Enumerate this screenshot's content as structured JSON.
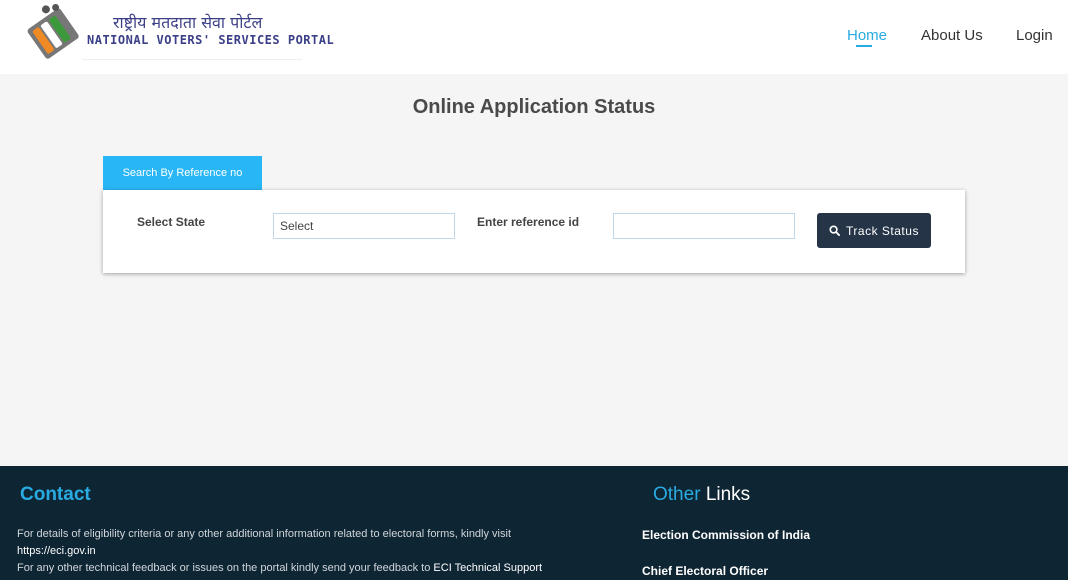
{
  "header": {
    "brand_hindi": "राष्ट्रीय मतदाता सेवा पोर्टल",
    "brand_english": "NATIONAL VOTERS' SERVICES PORTAL",
    "nav": {
      "home": "Home",
      "about": "About Us",
      "login": "Login"
    }
  },
  "main": {
    "title": "Online Application Status",
    "tab_label": "Search By Reference no",
    "form": {
      "state_label": "Select State",
      "state_value": "Select",
      "ref_label": "Enter reference id",
      "ref_value": "",
      "track_button": "Track Status"
    }
  },
  "footer": {
    "contact_title": "Contact",
    "contact_line1": "For details of eligibility criteria or any other additional information related to electoral forms, kindly visit",
    "contact_line2": "https://eci.gov.in",
    "contact_line3": "For any other technical feedback or issues on the portal kindly send your feedback to",
    "contact_line3_link": "ECI Technical Support",
    "links_title_accent": "Other",
    "links_title_rest": "Links",
    "links": [
      "Election Commission of India",
      "Chief Electoral Officer"
    ]
  },
  "colors": {
    "accent": "#29abe2",
    "tab_bg": "#29b6f6",
    "button_bg": "#253447",
    "footer_bg": "#0e2533"
  },
  "icons": {
    "logo": "voter-ink-finger-logo",
    "track_button": "search-icon"
  }
}
